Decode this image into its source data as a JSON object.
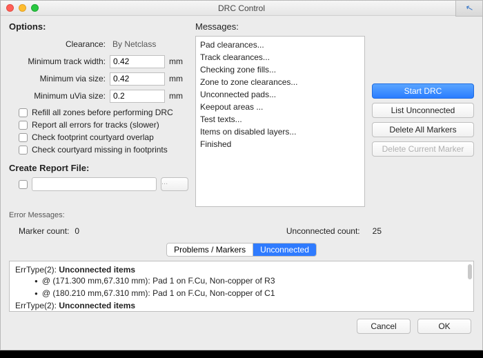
{
  "window": {
    "title": "DRC Control"
  },
  "options": {
    "section": "Options:",
    "clearance_label": "Clearance:",
    "clearance_value": "By Netclass",
    "min_track_label": "Minimum track width:",
    "min_track_value": "0.42",
    "min_via_label": "Minimum via size:",
    "min_via_value": "0.42",
    "min_uvia_label": "Minimum uVia size:",
    "min_uvia_value": "0.2",
    "unit": "mm",
    "checks": [
      "Refill all zones before performing DRC",
      "Report all errors for tracks (slower)",
      "Check footprint courtyard overlap",
      "Check courtyard missing in footprints"
    ],
    "report_section": "Create Report File:",
    "browse_label": "..."
  },
  "messages": {
    "section": "Messages:",
    "lines": [
      "Pad clearances...",
      "Track clearances...",
      "Checking zone fills...",
      "Zone to zone clearances...",
      "Unconnected pads...",
      "Keepout areas ...",
      "Test texts...",
      "Items on disabled layers...",
      "Finished"
    ]
  },
  "actions": {
    "start": "Start DRC",
    "list": "List Unconnected",
    "delete_all": "Delete All Markers",
    "delete_current": "Delete Current Marker"
  },
  "error_messages_label": "Error Messages:",
  "counts": {
    "marker_label": "Marker count:",
    "marker_value": "0",
    "unconnected_label": "Unconnected count:",
    "unconnected_value": "25"
  },
  "tabs": {
    "problems": "Problems / Markers",
    "unconnected": "Unconnected"
  },
  "results": {
    "err_prefix": "ErrType(2): ",
    "err_title": "Unconnected items",
    "line1": "@ (171.300 mm,67.310 mm): Pad 1 on F.Cu, Non-copper of R3",
    "line2": "@ (180.210 mm,67.310 mm): Pad 1 on F.Cu, Non-copper of C1"
  },
  "footer": {
    "cancel": "Cancel",
    "ok": "OK"
  }
}
